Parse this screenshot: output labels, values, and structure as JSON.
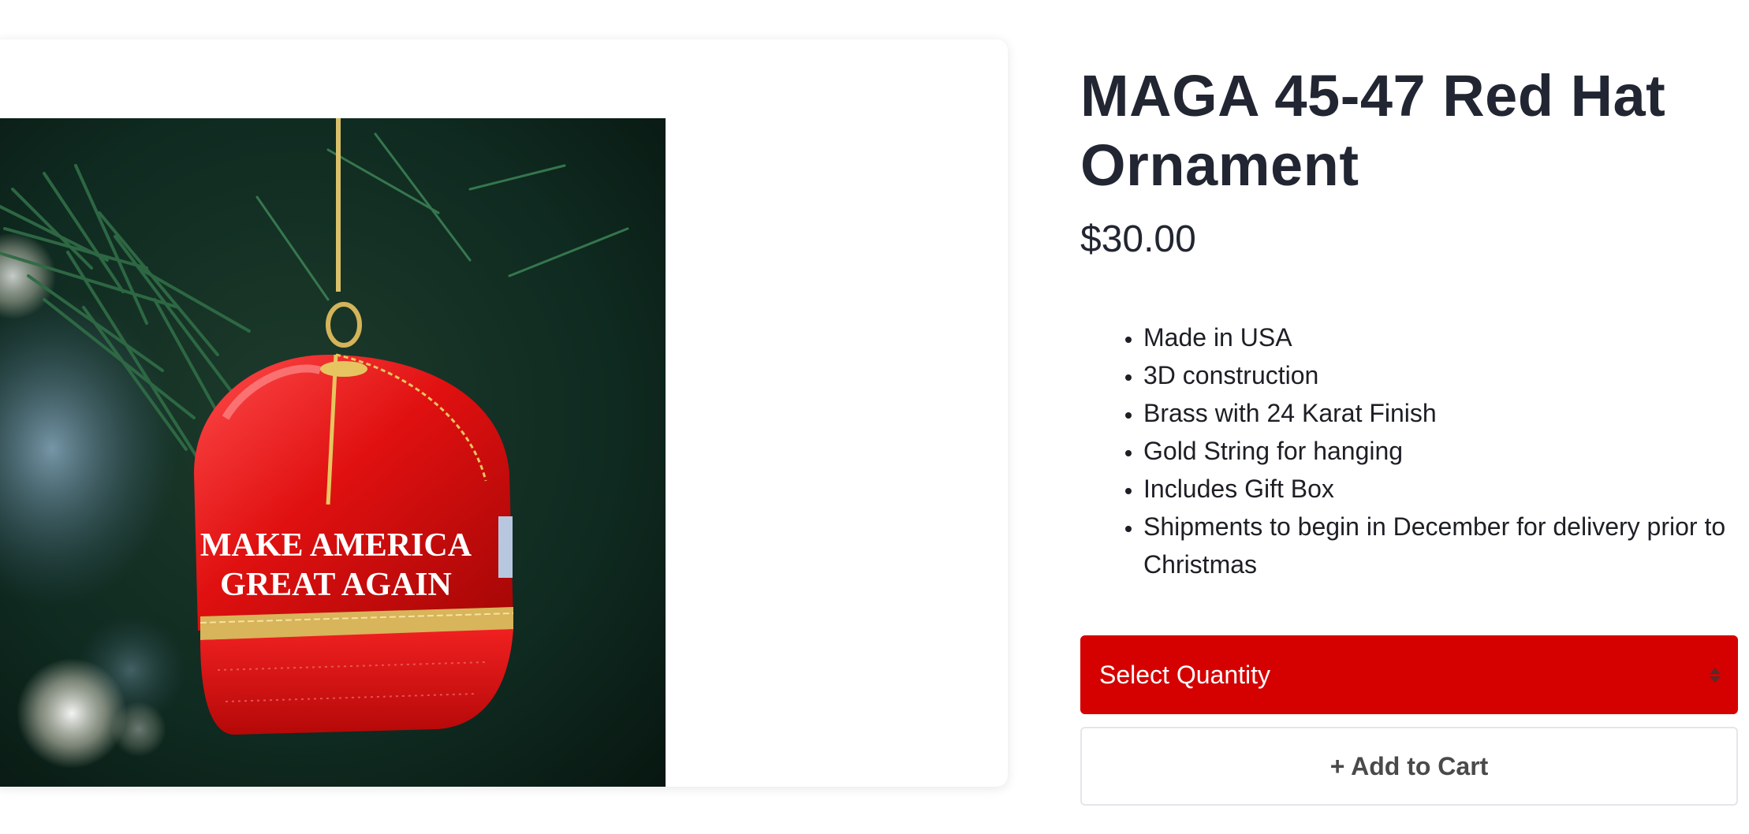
{
  "product": {
    "image_alt": "MAGA 45-47 red hat ornament hanging on a Christmas tree",
    "hat_text_line1": "MAKE AMERICA",
    "hat_text_line2": "GREAT AGAIN",
    "title": "MAGA 45-47 Red Hat Ornament",
    "price": "$30.00",
    "features": [
      "Made in USA",
      "3D construction",
      "Brass with 24 Karat Finish",
      "Gold String for hanging",
      "Includes Gift Box",
      "Shipments to begin in December for delivery prior to Christmas"
    ]
  },
  "quantity_select": {
    "label": "Select Quantity",
    "icon": "updown-arrows-icon"
  },
  "add_to_cart": {
    "label": "+ Add to Cart"
  },
  "colors": {
    "accent_red": "#d50000",
    "title_text": "#222632"
  }
}
